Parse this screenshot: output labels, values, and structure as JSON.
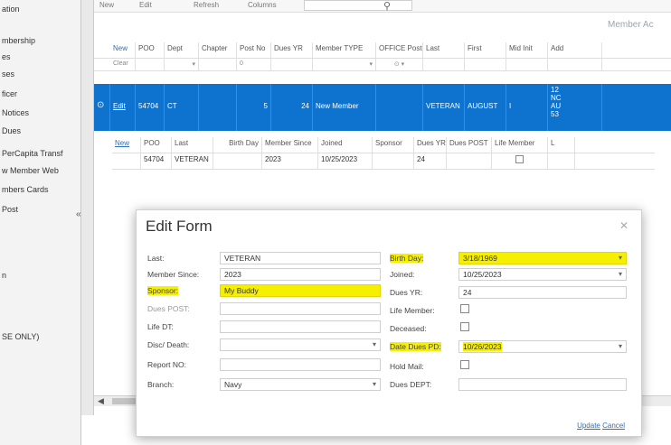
{
  "sidebar": {
    "items": [
      "ation",
      "mbership",
      "es",
      "ses",
      "ficer",
      "Notices",
      "Dues",
      "PerCapita Transf",
      "w Member Web",
      "mbers Cards",
      "Post",
      "n",
      "SE ONLY)"
    ],
    "collapse_glyph": "«"
  },
  "toolbar": {
    "items": [
      "New",
      "Edit",
      "Refresh",
      "Columns"
    ],
    "search_icon": "search-icon"
  },
  "grid": {
    "title": "Member Ac",
    "headers": [
      "New",
      "POO",
      "Dept",
      "Chapter",
      "Post No",
      "Dues YR",
      "Member TYPE",
      "OFFICE Post",
      "Last",
      "First",
      "Mid Init",
      "Add"
    ],
    "filter_row": [
      "Clear",
      "",
      "▾",
      "",
      "0",
      "",
      "▾",
      "⊙ ▾",
      "",
      "",
      "",
      ""
    ],
    "selected_row": {
      "marker": "⊙",
      "link": "Edit",
      "poo": "54704",
      "dept": "CT",
      "chapter": "",
      "post_no": "5",
      "dues_yr": "24",
      "member_type": "New Member",
      "office_post": "",
      "last": "VETERAN",
      "first": "AUGUST",
      "mid_init": "I",
      "address_lines": [
        "12",
        "NC",
        "AU",
        "53"
      ]
    }
  },
  "subgrid": {
    "headers": [
      "New",
      "POO",
      "Last",
      "Birth Day",
      "Member Since",
      "Joined",
      "Sponsor",
      "Dues YR",
      "Dues POST",
      "Life Member",
      "L"
    ],
    "row": [
      "",
      "54704",
      "VETERAN",
      "",
      "2023",
      "10/25/2023",
      "",
      "24",
      "",
      "",
      ""
    ]
  },
  "modal": {
    "title": "Edit Form",
    "close_glyph": "✕",
    "left_fields": [
      {
        "label": "Last:",
        "value": "VETERAN",
        "highlight": false,
        "dropdown": false
      },
      {
        "label": "Member Since:",
        "value": "2023",
        "highlight": false,
        "dropdown": false
      },
      {
        "label": "Sponsor:",
        "value": "My Buddy",
        "highlight": true,
        "dropdown": false
      },
      {
        "label": "Dues POST:",
        "value": "",
        "highlight": false,
        "dropdown": false
      },
      {
        "label": "Life DT:",
        "value": "",
        "highlight": false,
        "dropdown": false
      },
      {
        "label": "Disc/ Death:",
        "value": "",
        "highlight": false,
        "dropdown": true
      },
      {
        "label": "Report NO:",
        "value": "",
        "highlight": false,
        "dropdown": false
      },
      {
        "label": "Branch:",
        "value": "Navy",
        "highlight": false,
        "dropdown": true
      }
    ],
    "right_fields": [
      {
        "label": "Birth Day:",
        "value": "3/18/1969",
        "highlight": true,
        "type": "dropdown"
      },
      {
        "label": "Joined:",
        "value": "10/25/2023",
        "highlight": false,
        "type": "dropdown"
      },
      {
        "label": "Dues YR:",
        "value": "24",
        "highlight": false,
        "type": "text"
      },
      {
        "label": "Life Member:",
        "value": "",
        "highlight": false,
        "type": "checkbox"
      },
      {
        "label": "Deceased:",
        "value": "",
        "highlight": false,
        "type": "checkbox"
      },
      {
        "label": "Date Dues PD:",
        "value": "10/26/2023",
        "highlight": true,
        "type": "dropdown"
      },
      {
        "label": "Hold Mail:",
        "value": "",
        "highlight": false,
        "type": "checkbox"
      },
      {
        "label": "Dues DEPT:",
        "value": "",
        "highlight": false,
        "type": "text"
      }
    ],
    "actions": {
      "update": "Update",
      "cancel": "Cancel"
    }
  },
  "colors": {
    "selection": "#0e72cf",
    "highlight": "#f6f000",
    "link": "#2e6fb8"
  }
}
